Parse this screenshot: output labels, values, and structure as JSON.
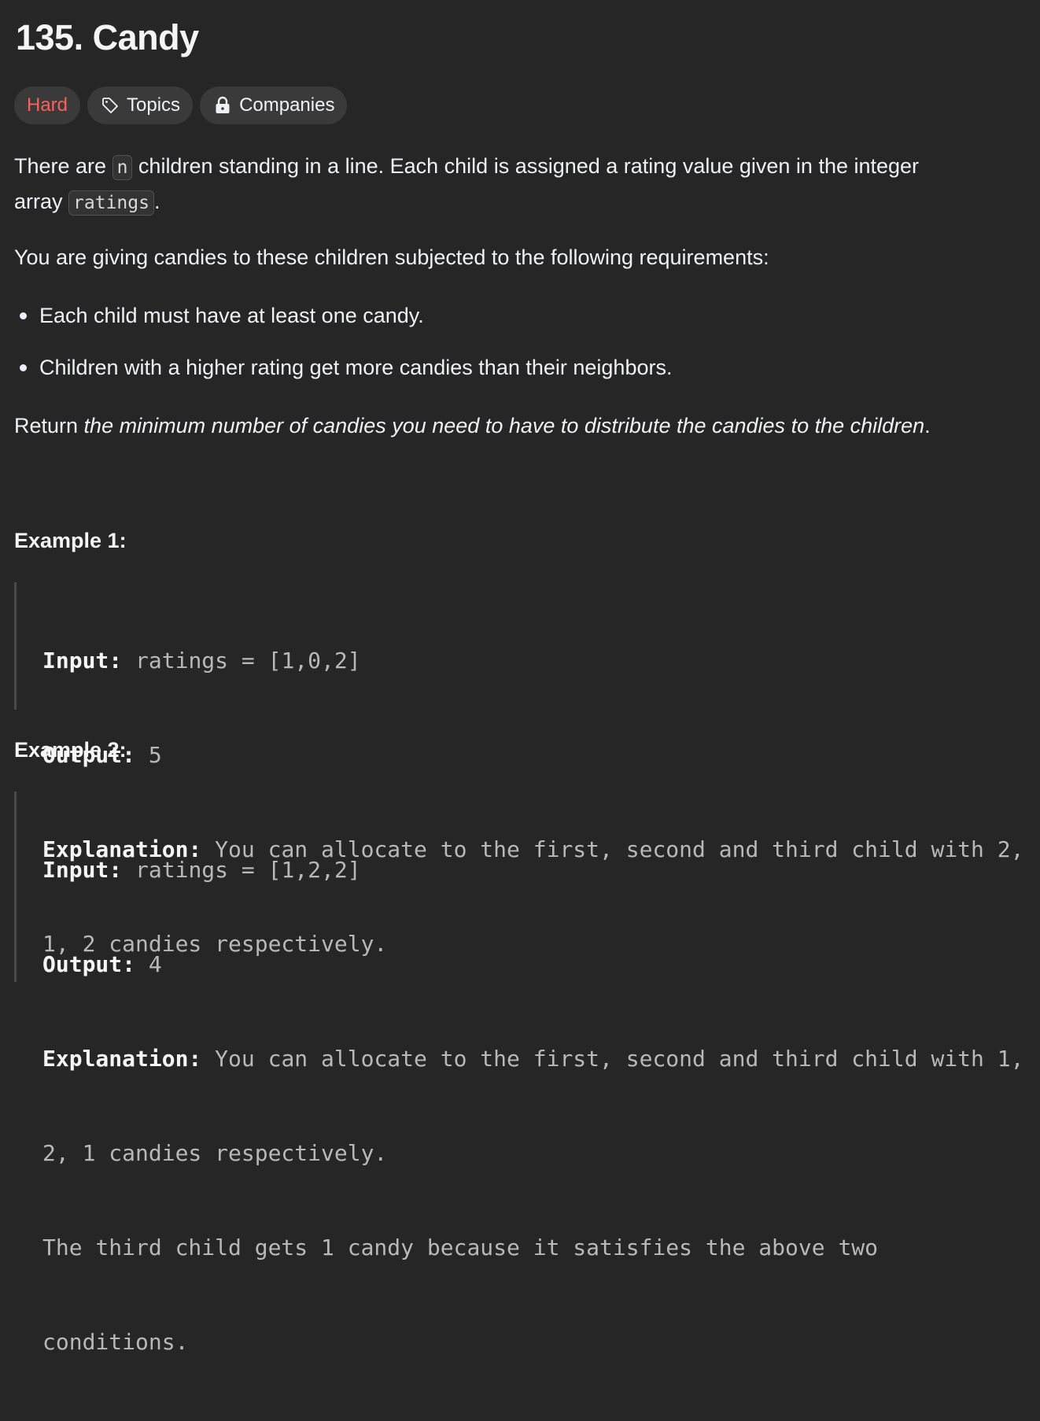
{
  "problem": {
    "title": "135. Candy",
    "difficulty": "Hard",
    "topics_label": "Topics",
    "companies_label": "Companies"
  },
  "description": {
    "p1_a": "There are ",
    "p1_code_n": "n",
    "p1_b": " children standing in a line. Each child is assigned a rating value given in the integer",
    "p1_c": "array ",
    "p1_code_ratings": "ratings",
    "p1_d": ".",
    "p2": "You are giving candies to these children subjected to the following requirements:",
    "requirements": [
      "Each child must have at least one candy.",
      "Children with a higher rating get more candies than their neighbors."
    ],
    "p3_a": "Return ",
    "p3_em": "the minimum number of candies you need to have to distribute the candies to the children",
    "p3_b": "."
  },
  "examples": [
    {
      "heading": "Example 1:",
      "input_label": "Input:",
      "input_value": " ratings = [1,0,2]",
      "output_label": "Output:",
      "output_value": " 5",
      "explanation_label": "Explanation:",
      "explanation_line1": " You can allocate to the first, second and third child with 2,",
      "explanation_line2": "1, 2 candies respectively."
    },
    {
      "heading": "Example 2:",
      "input_label": "Input:",
      "input_value": " ratings = [1,2,2]",
      "output_label": "Output:",
      "output_value": " 4",
      "explanation_label": "Explanation:",
      "explanation_line1": " You can allocate to the first, second and third child with 1,",
      "explanation_line2": "2, 1 candies respectively.",
      "explanation_line3": "The third child gets 1 candy because it satisfies the above two",
      "explanation_line4": "conditions."
    }
  ],
  "icons": {
    "topics": "tag-icon",
    "companies": "lock-icon"
  },
  "colors": {
    "background": "#262626",
    "hard": "#f8615c",
    "pill_bg": "#3a3a3a"
  }
}
